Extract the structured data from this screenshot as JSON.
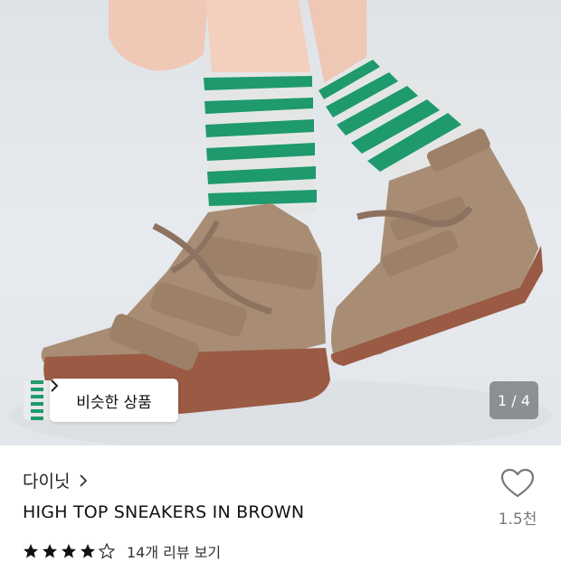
{
  "gallery": {
    "counter": "1 / 4",
    "similar_label": "비슷한 상품",
    "chevron": "›"
  },
  "product": {
    "brand": "다이닛",
    "title": "HIGH TOP SNEAKERS IN BROWN",
    "rating_stars": "★★★★★",
    "review_text": "14개 리뷰 보기",
    "rating_value": 4.5
  },
  "like": {
    "count": "1.5천"
  },
  "colors": {
    "suede": "#a88d74",
    "sole": "#9a5a44",
    "sock_green": "#1e9a6c",
    "sock_gray": "#e4e6e6",
    "background": "#e3e6ea"
  },
  "icons": {
    "heart": "heart-outline-icon",
    "chevron": "chevron-right-icon"
  }
}
